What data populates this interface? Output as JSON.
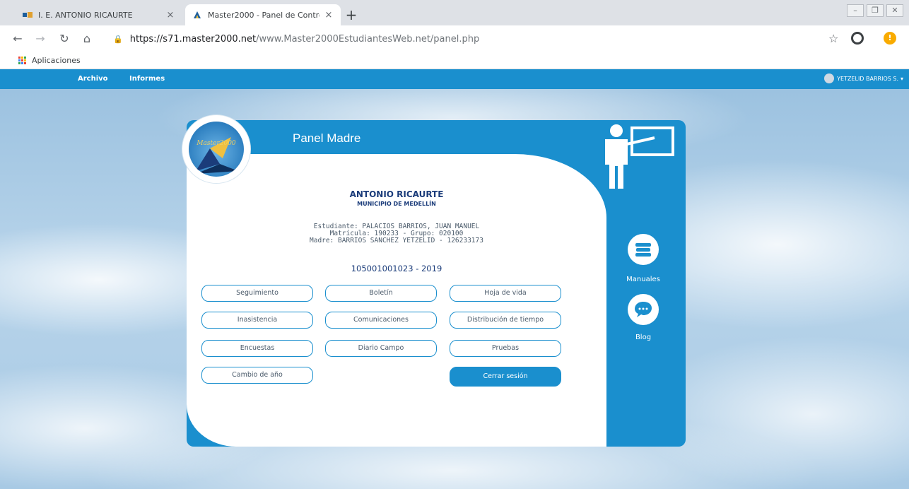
{
  "browser": {
    "tabs": [
      {
        "title": "I. E. ANTONIO RICAURTE",
        "active": false
      },
      {
        "title": "Master2000 - Panel de Control",
        "active": true
      }
    ],
    "close_glyph": "×",
    "new_tab_glyph": "+",
    "url_host": "https://s71.master2000.net",
    "url_path": "/www.Master2000EstudiantesWeb.net/panel.php",
    "bookmark_label": "Aplicaciones",
    "alert_glyph": "!"
  },
  "appnav": {
    "menu": [
      "Archivo",
      "Informes"
    ],
    "user": "YETZELID BARRIOS S."
  },
  "panel": {
    "logo_text": "Master2000",
    "title": "Panel Madre",
    "school_name": "ANTONIO RICAURTE",
    "municipality": "MUNICIPIO DE MEDELLÍN",
    "student_line": "Estudiante: PALACIOS BARRIOS, JUAN MANUEL",
    "enrollment_line": "Matrícula: 190233 - Grupo: 020100",
    "mother_line": "Madre: BARRIOS SANCHEZ YETZELID - 126233173",
    "code_year": "105001001023 - 2019",
    "buttons": {
      "seguimiento": "Seguimiento",
      "boletin": "Boletín",
      "hoja_de_vida": "Hoja de vida",
      "inasistencia": "Inasistencia",
      "comunicaciones": "Comunicaciones",
      "distribucion": "Distribución de tiempo",
      "encuestas": "Encuestas",
      "diario_campo": "Diario Campo",
      "pruebas": "Pruebas",
      "cambio_anio": "Cambio de año",
      "cerrar_sesion": "Cerrar sesión"
    },
    "side": {
      "manuales": "Manuales",
      "blog": "Blog"
    }
  },
  "colors": {
    "brand_blue": "#1a8fce",
    "navy_text": "#1b3c7a"
  }
}
